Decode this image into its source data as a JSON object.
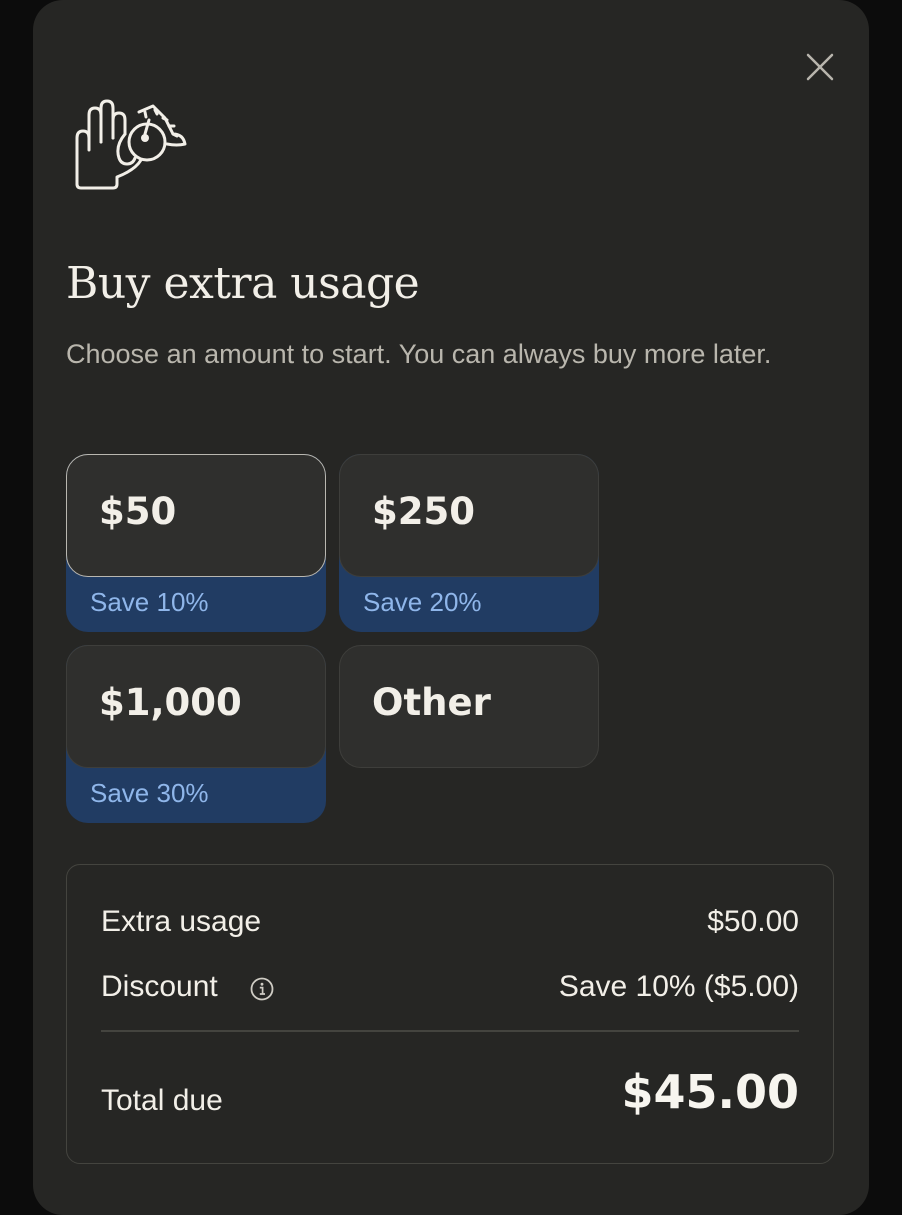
{
  "dialog": {
    "hero_icon": "hand-with-coin-icon",
    "close_icon": "close-icon",
    "title": "Buy extra usage",
    "subtitle": "Choose an amount to start. You can always buy more later."
  },
  "options": [
    {
      "amount": "$50",
      "save": "Save 10%",
      "selected": true
    },
    {
      "amount": "$250",
      "save": "Save 20%",
      "selected": false
    },
    {
      "amount": "$1,000",
      "save": "Save 30%",
      "selected": false
    },
    {
      "amount": "Other",
      "selected": false
    }
  ],
  "summary": {
    "extra_usage_label": "Extra usage",
    "extra_usage_value": "$50.00",
    "discount_label": "Discount",
    "discount_info_icon": "info-icon",
    "discount_value": "Save 10% ($5.00)",
    "total_label": "Total due",
    "total_value": "$45.00"
  },
  "colors": {
    "dialog_background": "#262624",
    "option_background": "#2f2f2d",
    "savings_background": "#213c63",
    "savings_text": "#8fb6ea",
    "primary_text": "#f2efe8",
    "secondary_text": "#b9b6ad"
  }
}
